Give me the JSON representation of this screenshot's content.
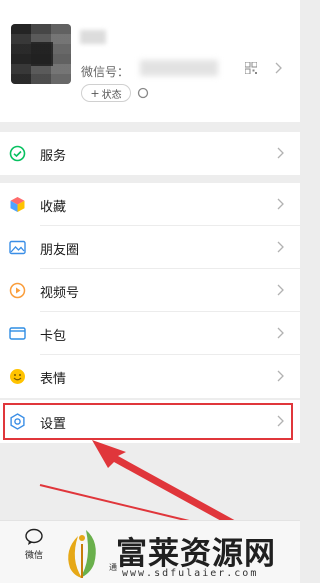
{
  "profile": {
    "wechat_id_label": "微信号：",
    "status_button_plus": "+",
    "status_button_label": "状态"
  },
  "menu": {
    "service": "服务",
    "favorites": "收藏",
    "moments": "朋友圈",
    "channels": "视频号",
    "cards": "卡包",
    "stickers": "表情",
    "settings": "设置"
  },
  "tabbar": {
    "chats_label": "微信",
    "partial_label": "通"
  },
  "watermark": {
    "title": "富莱资源网",
    "url": "www.sdfulaier.com"
  },
  "colors": {
    "highlight": "#e0363b",
    "wechat_green": "#07c160",
    "background": "#ededed"
  },
  "icons": {
    "service": "wallet-check-icon",
    "favorites": "cube-icon",
    "moments": "picture-icon",
    "channels": "play-circle-icon",
    "cards": "card-wallet-icon",
    "stickers": "smile-icon",
    "settings": "gear-icon"
  }
}
